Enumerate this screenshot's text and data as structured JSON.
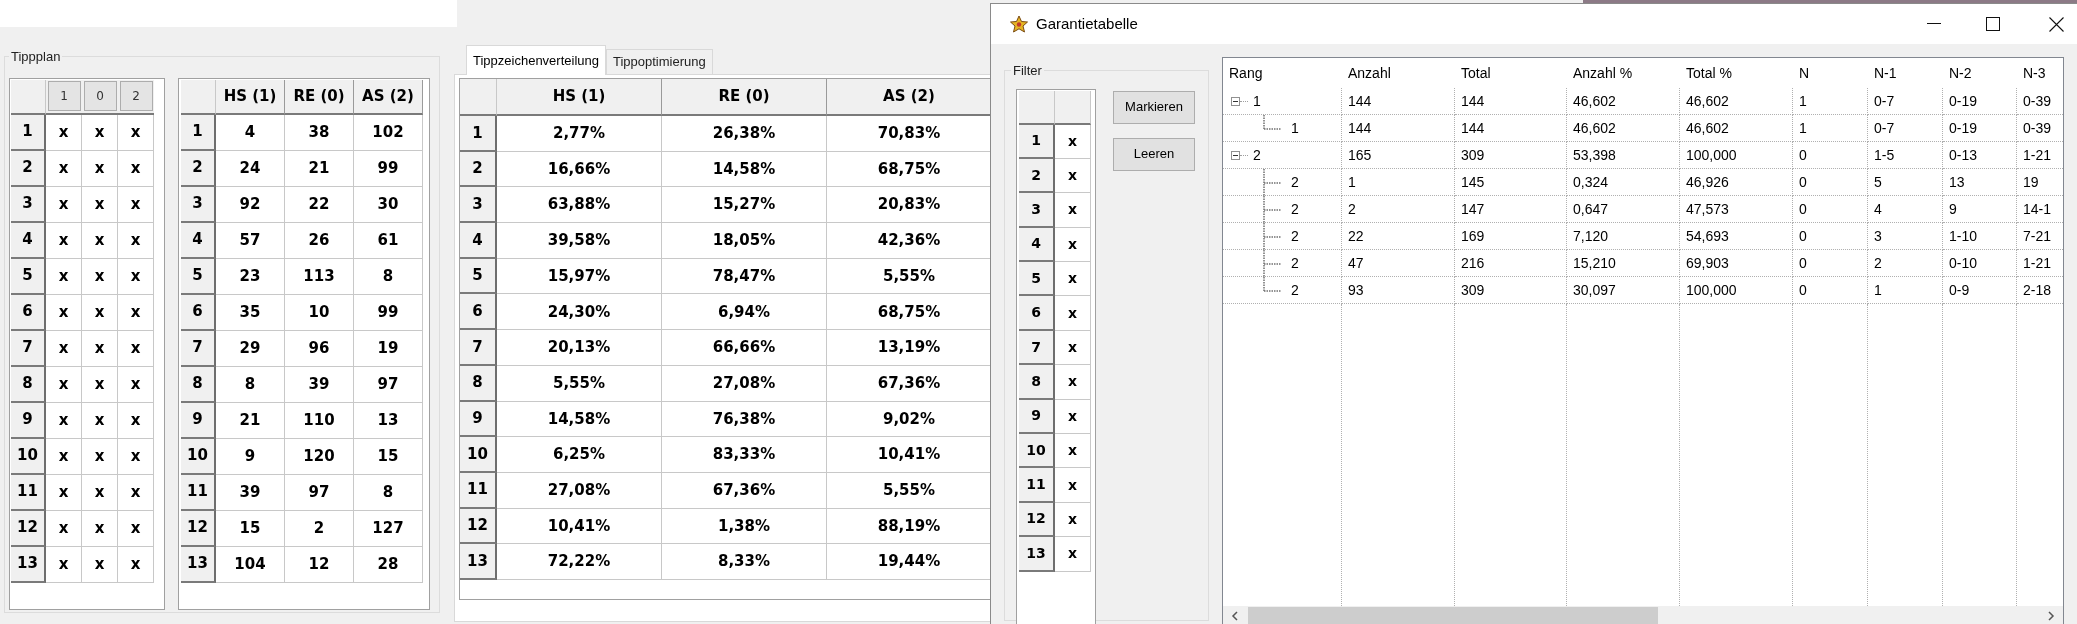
{
  "main": {
    "tipp_plan": {
      "title": "Tippplan",
      "pick_table": {
        "columns": [
          "1",
          "0",
          "2"
        ],
        "rows": [
          {
            "label": "1",
            "cells": [
              "x",
              "x",
              "x"
            ]
          },
          {
            "label": "2",
            "cells": [
              "x",
              "x",
              "x"
            ]
          },
          {
            "label": "3",
            "cells": [
              "x",
              "x",
              "x"
            ]
          },
          {
            "label": "4",
            "cells": [
              "x",
              "x",
              "x"
            ]
          },
          {
            "label": "5",
            "cells": [
              "x",
              "x",
              "x"
            ]
          },
          {
            "label": "6",
            "cells": [
              "x",
              "x",
              "x"
            ]
          },
          {
            "label": "7",
            "cells": [
              "x",
              "x",
              "x"
            ]
          },
          {
            "label": "8",
            "cells": [
              "x",
              "x",
              "x"
            ]
          },
          {
            "label": "9",
            "cells": [
              "x",
              "x",
              "x"
            ]
          },
          {
            "label": "10",
            "cells": [
              "x",
              "x",
              "x"
            ]
          },
          {
            "label": "11",
            "cells": [
              "x",
              "x",
              "x"
            ]
          },
          {
            "label": "12",
            "cells": [
              "x",
              "x",
              "x"
            ]
          },
          {
            "label": "13",
            "cells": [
              "x",
              "x",
              "x"
            ]
          }
        ]
      },
      "count_table": {
        "columns": [
          "HS (1)",
          "RE (0)",
          "AS (2)"
        ],
        "rows": [
          {
            "label": "1",
            "cells": [
              "4",
              "38",
              "102"
            ]
          },
          {
            "label": "2",
            "cells": [
              "24",
              "21",
              "99"
            ]
          },
          {
            "label": "3",
            "cells": [
              "92",
              "22",
              "30"
            ]
          },
          {
            "label": "4",
            "cells": [
              "57",
              "26",
              "61"
            ]
          },
          {
            "label": "5",
            "cells": [
              "23",
              "113",
              "8"
            ]
          },
          {
            "label": "6",
            "cells": [
              "35",
              "10",
              "99"
            ]
          },
          {
            "label": "7",
            "cells": [
              "29",
              "96",
              "19"
            ]
          },
          {
            "label": "8",
            "cells": [
              "8",
              "39",
              "97"
            ]
          },
          {
            "label": "9",
            "cells": [
              "21",
              "110",
              "13"
            ]
          },
          {
            "label": "10",
            "cells": [
              "9",
              "120",
              "15"
            ]
          },
          {
            "label": "11",
            "cells": [
              "39",
              "97",
              "8"
            ]
          },
          {
            "label": "12",
            "cells": [
              "15",
              "2",
              "127"
            ]
          },
          {
            "label": "13",
            "cells": [
              "104",
              "12",
              "28"
            ]
          }
        ]
      }
    },
    "tabs": [
      {
        "label": "Tippzeichenverteilung",
        "selected": true
      },
      {
        "label": "Tippoptimierung",
        "selected": false
      }
    ],
    "distribution_table": {
      "columns": [
        "HS (1)",
        "RE (0)",
        "AS (2)"
      ],
      "rows": [
        {
          "label": "1",
          "cells": [
            "2,77%",
            "26,38%",
            "70,83%"
          ]
        },
        {
          "label": "2",
          "cells": [
            "16,66%",
            "14,58%",
            "68,75%"
          ]
        },
        {
          "label": "3",
          "cells": [
            "63,88%",
            "15,27%",
            "20,83%"
          ]
        },
        {
          "label": "4",
          "cells": [
            "39,58%",
            "18,05%",
            "42,36%"
          ]
        },
        {
          "label": "5",
          "cells": [
            "15,97%",
            "78,47%",
            "5,55%"
          ]
        },
        {
          "label": "6",
          "cells": [
            "24,30%",
            "6,94%",
            "68,75%"
          ]
        },
        {
          "label": "7",
          "cells": [
            "20,13%",
            "66,66%",
            "13,19%"
          ]
        },
        {
          "label": "8",
          "cells": [
            "5,55%",
            "27,08%",
            "67,36%"
          ]
        },
        {
          "label": "9",
          "cells": [
            "14,58%",
            "76,38%",
            "9,02%"
          ]
        },
        {
          "label": "10",
          "cells": [
            "6,25%",
            "83,33%",
            "10,41%"
          ]
        },
        {
          "label": "11",
          "cells": [
            "27,08%",
            "67,36%",
            "5,55%"
          ]
        },
        {
          "label": "12",
          "cells": [
            "10,41%",
            "1,38%",
            "88,19%"
          ]
        },
        {
          "label": "13",
          "cells": [
            "72,22%",
            "8,33%",
            "19,44%"
          ]
        }
      ]
    }
  },
  "dialog": {
    "title": "Garantietabelle",
    "filter": {
      "title": "Filter",
      "rows": [
        {
          "label": "1",
          "value": "x"
        },
        {
          "label": "2",
          "value": "x"
        },
        {
          "label": "3",
          "value": "x"
        },
        {
          "label": "4",
          "value": "x"
        },
        {
          "label": "5",
          "value": "x"
        },
        {
          "label": "6",
          "value": "x"
        },
        {
          "label": "7",
          "value": "x"
        },
        {
          "label": "8",
          "value": "x"
        },
        {
          "label": "9",
          "value": "x"
        },
        {
          "label": "10",
          "value": "x"
        },
        {
          "label": "11",
          "value": "x"
        },
        {
          "label": "12",
          "value": "x"
        },
        {
          "label": "13",
          "value": "x"
        }
      ]
    },
    "buttons": [
      "Markieren",
      "Leeren"
    ],
    "tree_table": {
      "columns": [
        "Rang",
        "Anzahl",
        "Total",
        "Anzahl %",
        "Total %",
        "N",
        "N-1",
        "N-2",
        "N-3"
      ],
      "rows": [
        {
          "expanded": true,
          "cells": [
            "1",
            "144",
            "144",
            "46,602",
            "46,602",
            "1",
            "0-7",
            "0-19",
            "0-39"
          ],
          "children": [
            {
              "cells": [
                "1",
                "144",
                "144",
                "46,602",
                "46,602",
                "1",
                "0-7",
                "0-19",
                "0-39"
              ]
            }
          ]
        },
        {
          "expanded": true,
          "cells": [
            "2",
            "165",
            "309",
            "53,398",
            "100,000",
            "0",
            "1-5",
            "0-13",
            "1-21"
          ],
          "children": [
            {
              "cells": [
                "2",
                "1",
                "145",
                "0,324",
                "46,926",
                "0",
                "5",
                "13",
                "19"
              ]
            },
            {
              "cells": [
                "2",
                "2",
                "147",
                "0,647",
                "47,573",
                "0",
                "4",
                "9",
                "14-1"
              ]
            },
            {
              "cells": [
                "2",
                "22",
                "169",
                "7,120",
                "54,693",
                "0",
                "3",
                "1-10",
                "7-21"
              ]
            },
            {
              "cells": [
                "2",
                "47",
                "216",
                "15,210",
                "69,903",
                "0",
                "2",
                "0-10",
                "1-21"
              ]
            },
            {
              "cells": [
                "2",
                "93",
                "309",
                "30,097",
                "100,000",
                "0",
                "1",
                "0-9",
                "2-18"
              ]
            }
          ]
        }
      ]
    }
  }
}
